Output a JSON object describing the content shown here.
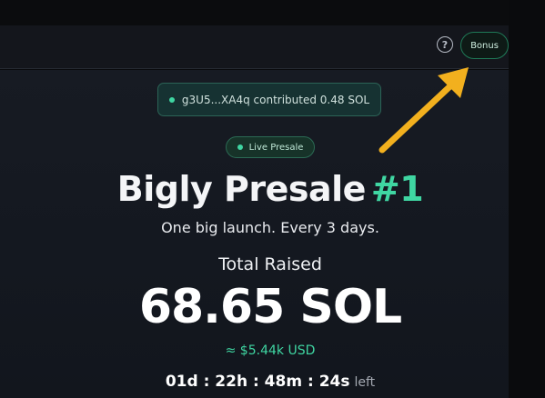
{
  "header": {
    "help_icon": "question-circle-icon",
    "help_glyph": "?",
    "bonus_label": "Bonus"
  },
  "toast": {
    "text": "g3U5...XA4q contributed 0.48 SOL",
    "indicator_color": "#3fd6a2"
  },
  "badge": {
    "label": "Live Presale"
  },
  "presale": {
    "title": "Bigly Presale",
    "number": "#1",
    "tagline": "One big launch. Every 3 days.",
    "raised_label": "Total Raised",
    "raised_value": "68.65 SOL",
    "usd_value": "≈ $5.44k USD",
    "countdown": "01d : 22h : 48m : 24s",
    "countdown_suffix": "left"
  },
  "colors": {
    "accent": "#3fd6a2",
    "annotation_arrow": "#f2b01e",
    "background": "#141820"
  }
}
